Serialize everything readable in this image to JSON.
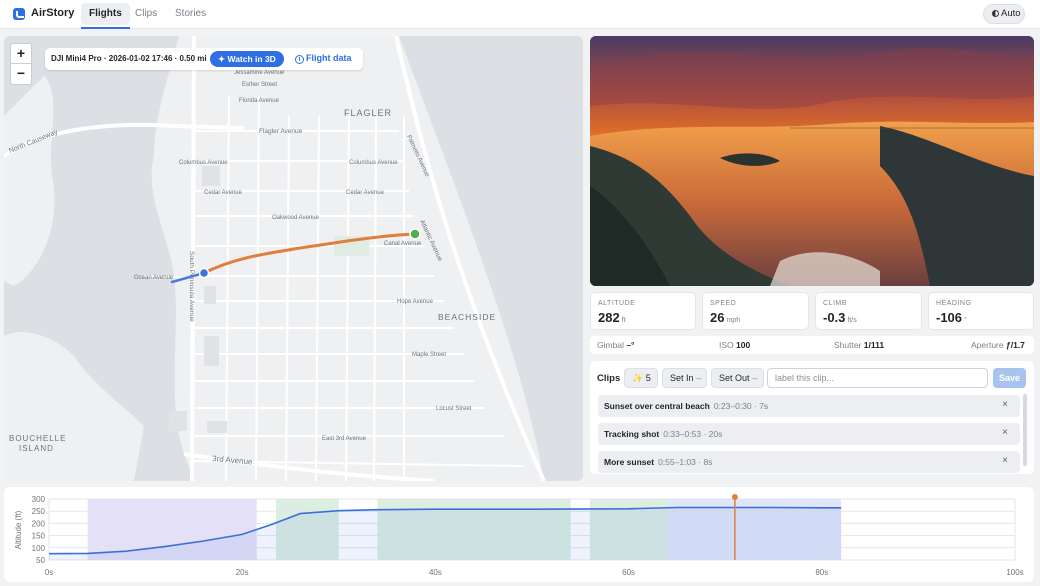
{
  "app": {
    "name": "AirStory"
  },
  "nav": {
    "tabs": [
      "Flights",
      "Clips",
      "Stories"
    ],
    "active": "Flights"
  },
  "theme": {
    "label": "Auto"
  },
  "map": {
    "zoom_in": "+",
    "zoom_out": "−",
    "flight_info": "DJI Mini4 Pro · 2026-01-02 17:46 · 0.50 mi",
    "watch_3d": "Watch in 3D",
    "flight_data": "Flight data",
    "labels": {
      "flagler": "FLAGLER",
      "beachside": "BEACHSIDE",
      "bouchelle1": "BOUCHELLE",
      "bouchelle2": "ISLAND",
      "north_causeway": "North Causeway",
      "flagler_avenue": "Flagler Avenue",
      "columbus_avenue": "Columbus Avenue",
      "cedar_avenue": "Cedar Avenue",
      "cedar_avenue2": "Cedar Avenue",
      "oakwood_avenue": "Oakwood Avenue",
      "ocean_avenue": "Ocean Avenue",
      "canal_avenue": "Canal Avenue",
      "hope_avenue": "Hope Avenue",
      "maple_street": "Maple Street",
      "locust_street": "Locust Street",
      "east_3rd": "East 3rd Avenue",
      "third_avenue": "3rd Avenue",
      "atlantic_avenue": "Atlantic Avenue",
      "south_peninsula": "South Peninsula Avenue",
      "esther_street": "Esther Street",
      "florida_avenue": "Florida Avenue",
      "jessamine_avenue": "Jessamine Avenue",
      "columbus_avenue2": "Columbus Avenue",
      "palmetto_avenue": "Palmetto Avenue"
    },
    "colors": {
      "flown_path": "#e07f3c",
      "remaining_path": "#4a7be3",
      "start_marker": "#4caf50",
      "current_marker": "#3b73e0"
    }
  },
  "telemetry": [
    {
      "label": "ALTITUDE",
      "value": "282",
      "unit": "ft"
    },
    {
      "label": "SPEED",
      "value": "26",
      "unit": "mph"
    },
    {
      "label": "CLIMB",
      "value": "-0.3",
      "unit": "ft/s"
    },
    {
      "label": "HEADING",
      "value": "-106",
      "unit": "°"
    }
  ],
  "camera": {
    "gimbal_label": "Gimbal",
    "gimbal_value": "–°",
    "iso_label": "ISO",
    "iso_value": "100",
    "shutter_label": "Shutter",
    "shutter_value": "1/111",
    "aperture_label": "Aperture",
    "aperture_value": "ƒ/1.7"
  },
  "clips": {
    "title": "Clips",
    "magic_count": "5",
    "set_in": "Set In",
    "set_out": "Set Out",
    "dash": "–",
    "label_placeholder": "label this clip...",
    "save": "Save",
    "items": [
      {
        "name": "Sunset over central beach",
        "meta": "0:23–0:30 · 7s"
      },
      {
        "name": "Tracking shot",
        "meta": "0:33–0:53 · 20s"
      },
      {
        "name": "More sunset",
        "meta": "0:55–1:03 · 8s"
      }
    ],
    "remove_icon": "×"
  },
  "chart_data": {
    "type": "line",
    "ylabel": "Altitude (ft)",
    "xlabel": "",
    "xlim": [
      0,
      100
    ],
    "ylim": [
      50,
      300
    ],
    "x_tick_labels": [
      "0s",
      "20s",
      "40s",
      "60s",
      "80s",
      "100s"
    ],
    "y_tick_labels": [
      "300",
      "250",
      "200",
      "150",
      "100",
      "50"
    ],
    "series": [
      {
        "x": [
          0,
          4,
          8,
          12,
          16,
          20,
          23,
          26,
          30,
          34,
          40,
          50,
          60,
          65,
          70,
          75,
          80,
          82
        ],
        "y": [
          76,
          77,
          86,
          105,
          128,
          155,
          195,
          240,
          252,
          256,
          258,
          258,
          260,
          265,
          265,
          265,
          264,
          264
        ]
      }
    ],
    "clip_ranges": [
      {
        "start": 4,
        "end": 21.5,
        "color": "#dcd6f7"
      },
      {
        "start": 23.5,
        "end": 30,
        "color": "#cfe8d6"
      },
      {
        "start": 34,
        "end": 54,
        "color": "#cfe8d6"
      },
      {
        "start": 56,
        "end": 64,
        "color": "#cfe8d6"
      },
      {
        "start": 64,
        "end": 82,
        "color": "#d6dcf7"
      }
    ],
    "playhead": 71
  }
}
